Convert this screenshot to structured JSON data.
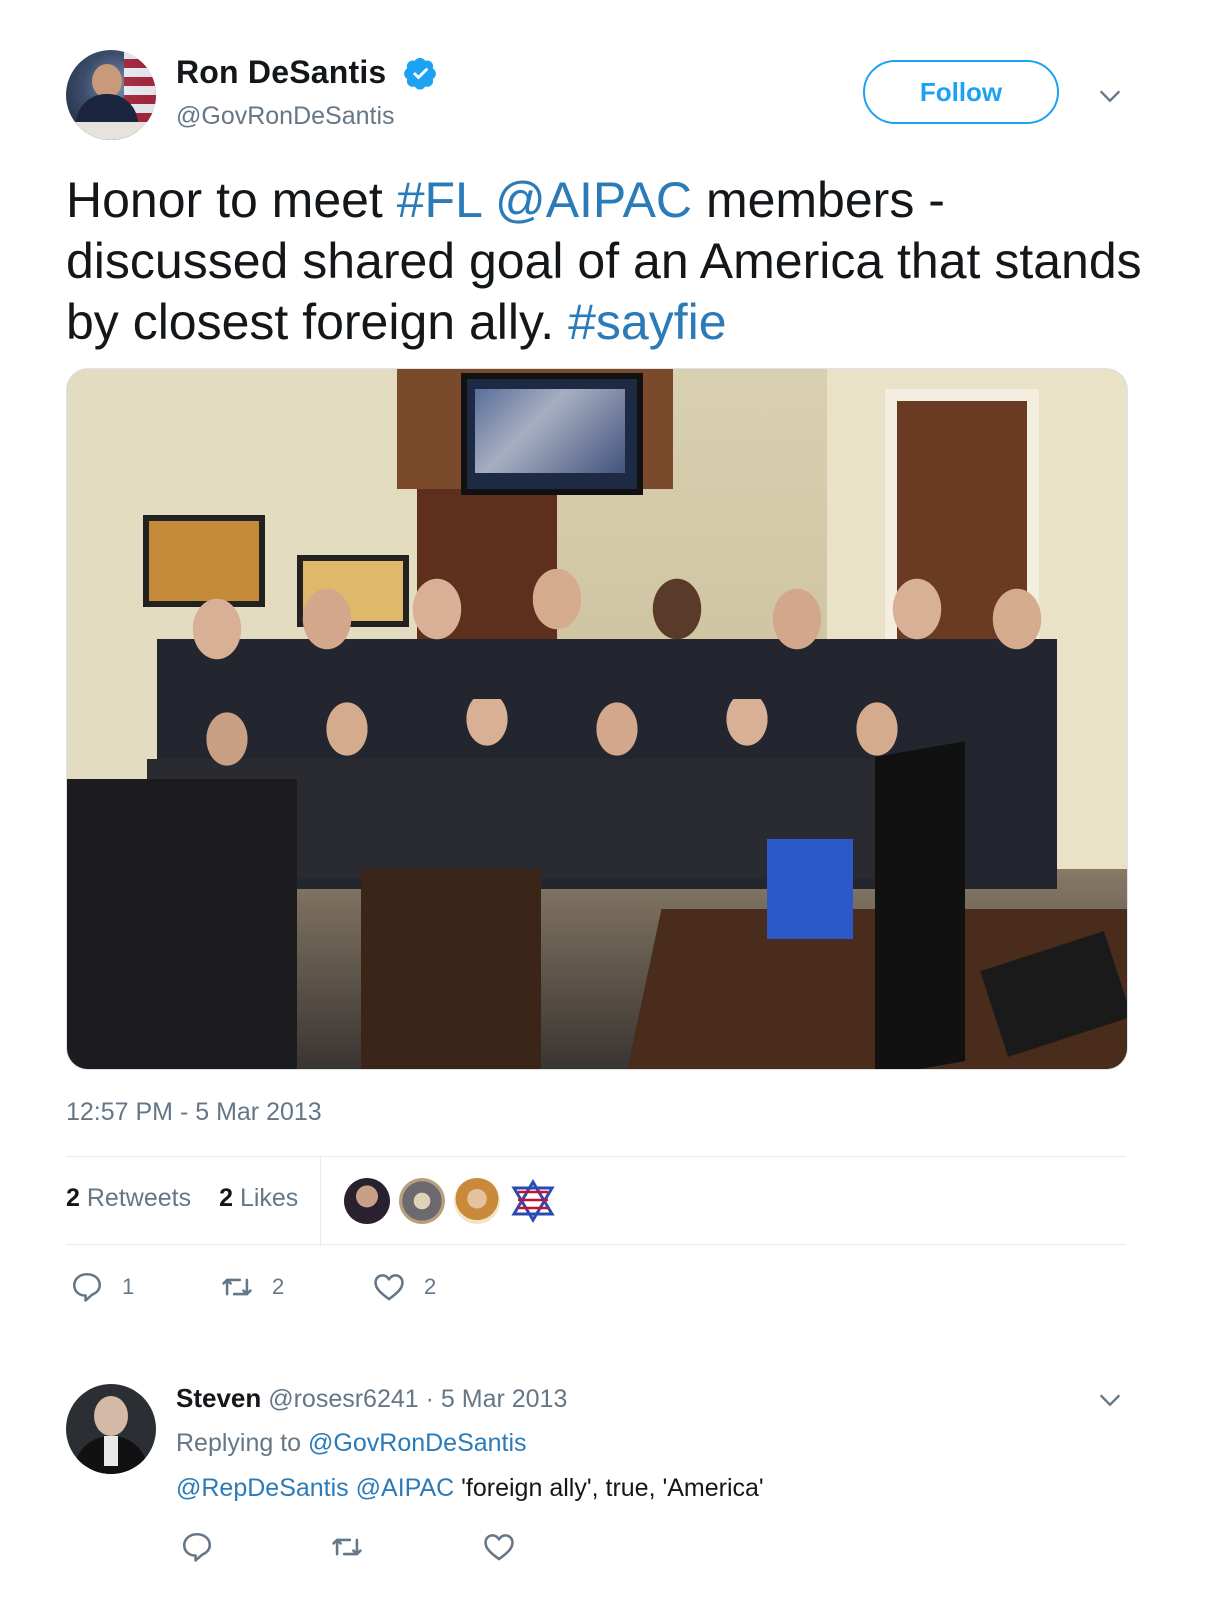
{
  "tweet": {
    "author": {
      "name": "Ron DeSantis",
      "handle": "@GovRonDeSantis",
      "verified": true
    },
    "follow_label": "Follow",
    "text_parts": [
      {
        "text": "Honor to meet ",
        "type": "text"
      },
      {
        "text": "#FL",
        "type": "hashtag"
      },
      {
        "text": " ",
        "type": "text"
      },
      {
        "text": "@AIPAC",
        "type": "mention"
      },
      {
        "text": " members - discussed shared goal of an America that stands by closest foreign ally. ",
        "type": "text"
      },
      {
        "text": "#sayfie",
        "type": "hashtag"
      }
    ],
    "timestamp": "12:57 PM - 5 Mar 2013",
    "stats": {
      "retweets_count": "2",
      "retweets_label": "Retweets",
      "likes_count": "2",
      "likes_label": "Likes"
    },
    "actions": {
      "reply_count": "1",
      "retweet_count": "2",
      "like_count": "2"
    }
  },
  "reply": {
    "name": "Steven",
    "handle": "@rosesr6241",
    "date": "· 5 Mar 2013",
    "replying_to_label": "Replying to",
    "replying_to_handle": "@GovRonDeSantis",
    "mention1": "@RepDeSantis",
    "mention2": "@AIPAC",
    "text": "'foreign ally', true, 'America'"
  },
  "colors": {
    "link": "#2b7bb9",
    "follow_blue": "#1da1f2",
    "secondary_text": "#657786",
    "primary_text": "#14171a",
    "divider": "#e6ecf0"
  },
  "icons": {
    "verified": "verified-badge-icon",
    "chevron": "chevron-down-icon",
    "reply": "reply-icon",
    "retweet": "retweet-icon",
    "like": "heart-icon"
  }
}
